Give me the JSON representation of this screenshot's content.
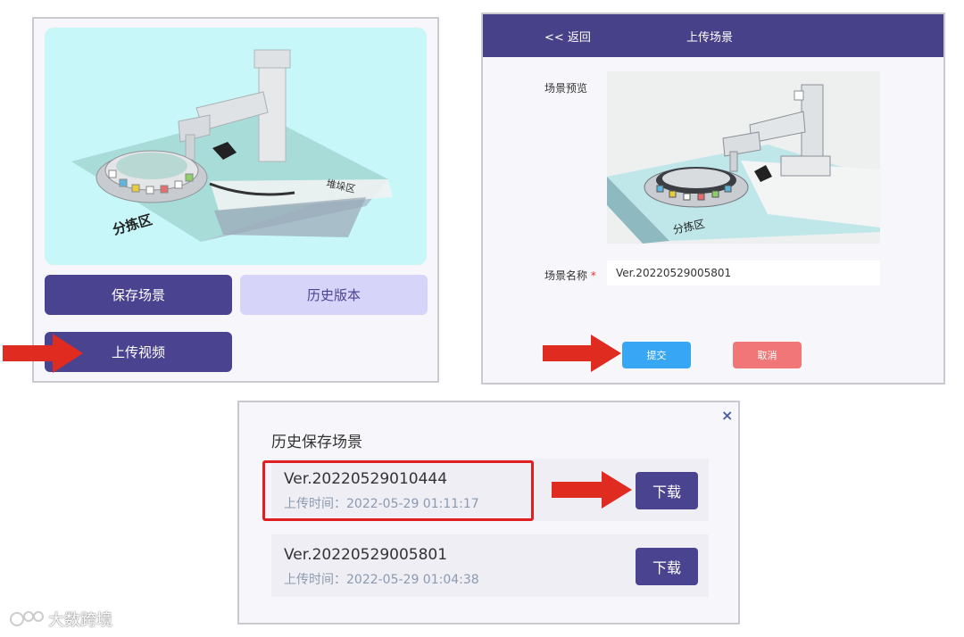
{
  "left_panel": {
    "scene_zone_label": "分拣区",
    "scene_zone_label_2": "堆垛区",
    "save_label": "保存场景",
    "history_label": "历史版本",
    "upload_label": "上传视频"
  },
  "right_panel": {
    "back_label": "<< 返回",
    "title": "上传场景",
    "preview_label": "场景预览",
    "name_label": "场景名称",
    "required_mark": "*",
    "name_value": "Ver.20220529005801",
    "scene_zone_label": "分拣区",
    "submit_label": "提交",
    "cancel_label": "取消"
  },
  "dialog": {
    "title": "历史保存场景",
    "close_glyph": "×",
    "items": [
      {
        "version": "Ver.20220529010444",
        "time": "上传时间：2022-05-29 01:11:17",
        "download_label": "下载"
      },
      {
        "version": "Ver.20220529005801",
        "time": "上传时间：2022-05-29 01:04:38",
        "download_label": "下载"
      }
    ]
  },
  "watermark": "大数跨境",
  "colors": {
    "primary": "#4a4490",
    "header": "#474189",
    "light_button": "#d7d4fa",
    "submit": "#37a6f5",
    "cancel": "#f07677",
    "arrow": "#e02b20",
    "preview_bg": "#c8f7f9"
  }
}
